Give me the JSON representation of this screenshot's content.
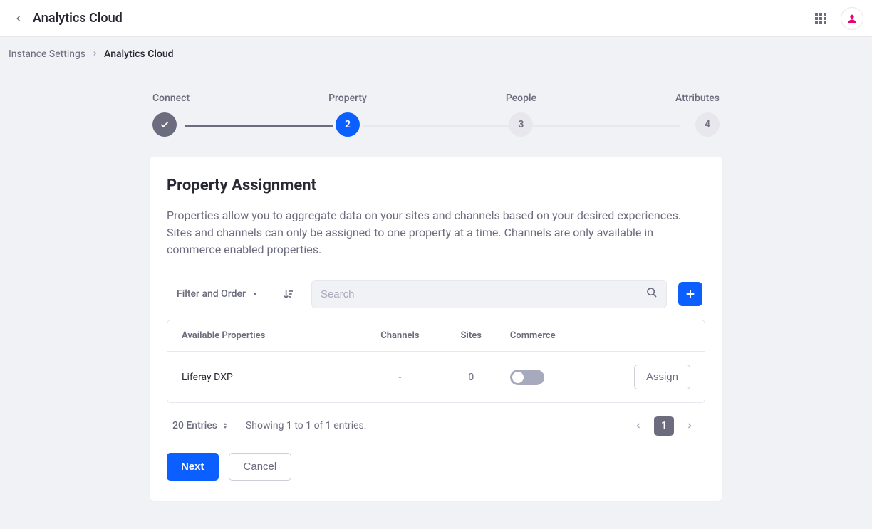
{
  "header": {
    "title": "Analytics Cloud"
  },
  "breadcrumbs": {
    "parent": "Instance Settings",
    "current": "Analytics Cloud"
  },
  "wizard": {
    "steps": [
      {
        "label": "Connect",
        "num": "✓"
      },
      {
        "label": "Property",
        "num": "2"
      },
      {
        "label": "People",
        "num": "3"
      },
      {
        "label": "Attributes",
        "num": "4"
      }
    ]
  },
  "panel": {
    "title": "Property Assignment",
    "desc": "Properties allow you to aggregate data on your sites and channels based on your desired experiences. Sites and channels can only be assigned to one property at a time. Channels are only available in commerce enabled properties."
  },
  "toolbar": {
    "filter_label": "Filter and Order",
    "search_placeholder": "Search"
  },
  "table": {
    "headers": {
      "name": "Available Properties",
      "channels": "Channels",
      "sites": "Sites",
      "commerce": "Commerce"
    },
    "rows": [
      {
        "name": "Liferay DXP",
        "channels": "-",
        "sites": "0",
        "assign_label": "Assign"
      }
    ]
  },
  "pagination": {
    "entries_label": "20 Entries",
    "showing": "Showing 1 to 1 of 1 entries.",
    "page": "1"
  },
  "actions": {
    "next": "Next",
    "cancel": "Cancel"
  }
}
